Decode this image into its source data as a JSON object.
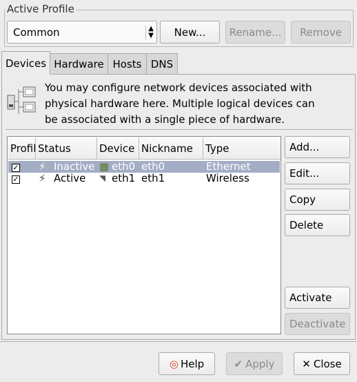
{
  "profile": {
    "label": "Active Profile",
    "selected": "Common",
    "new_label": "New...",
    "rename_label": "Rename...",
    "remove_label": "Remove"
  },
  "tabs": [
    {
      "label": "Devices",
      "active": true
    },
    {
      "label": "Hardware",
      "active": false
    },
    {
      "label": "Hosts",
      "active": false
    },
    {
      "label": "DNS",
      "active": false
    }
  ],
  "info": {
    "line1": "You may configure network devices associated with",
    "line2": "physical hardware here.  Multiple logical devices can",
    "line3": "be associated with a single piece of hardware."
  },
  "table": {
    "columns": [
      "Profile",
      "Status",
      "Device",
      "Nickname",
      "Type"
    ],
    "rows": [
      {
        "profile": true,
        "status": "Inactive",
        "device": "eth0",
        "nickname": "eth0",
        "type": "Ethernet",
        "selected": true
      },
      {
        "profile": true,
        "status": "Active",
        "device": "eth1",
        "nickname": "eth1",
        "type": "Wireless",
        "selected": false
      }
    ]
  },
  "actions": {
    "add": "Add...",
    "edit": "Edit...",
    "copy": "Copy",
    "delete": "Delete",
    "activate": "Activate",
    "deactivate": "Deactivate"
  },
  "footer": {
    "help": "Help",
    "apply": "Apply",
    "close": "Close"
  },
  "colors": {
    "selection": "#a3adc5",
    "background": "#ececec"
  }
}
